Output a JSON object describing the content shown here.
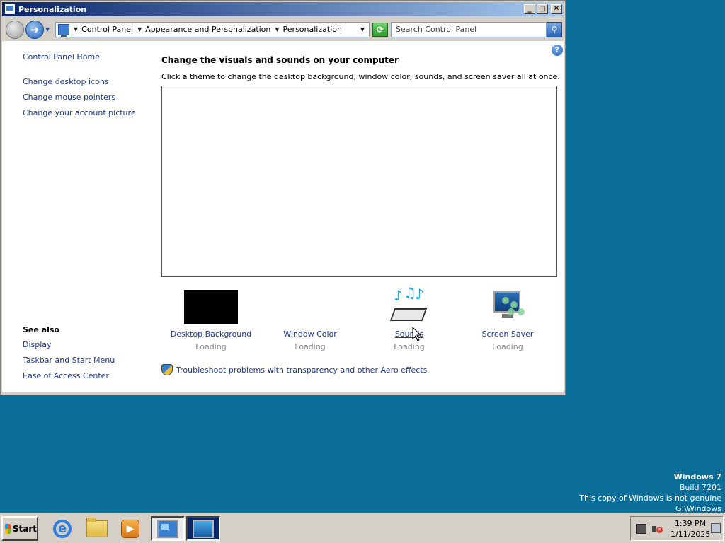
{
  "window": {
    "title": "Personalization",
    "controls": {
      "minimize": "_",
      "maximize": "□",
      "close": "✕"
    }
  },
  "addressbar": {
    "breadcrumbs": [
      "Control Panel",
      "Appearance and Personalization",
      "Personalization"
    ],
    "search_placeholder": "Search Control Panel"
  },
  "sidebar": {
    "home": "Control Panel Home",
    "links": [
      "Change desktop icons",
      "Change mouse pointers",
      "Change your account picture"
    ],
    "see_also_title": "See also",
    "see_also": [
      "Display",
      "Taskbar and Start Menu",
      "Ease of Access Center"
    ]
  },
  "main": {
    "heading": "Change the visuals and sounds on your computer",
    "subheading": "Click a theme to change the desktop background, window color, sounds, and screen saver all at once.",
    "options": [
      {
        "label": "Desktop Background",
        "status": "Loading"
      },
      {
        "label": "Window Color",
        "status": "Loading"
      },
      {
        "label": "Sounds",
        "status": "Loading"
      },
      {
        "label": "Screen Saver",
        "status": "Loading"
      }
    ],
    "troubleshoot": "Troubleshoot problems with transparency and other Aero effects"
  },
  "watermark": {
    "title": "Windows 7",
    "build": "Build 7201",
    "genuine": "This copy of Windows is not genuine",
    "path": "G:\\Windows"
  },
  "taskbar": {
    "start_label": "Start",
    "clock_time": "1:39 PM",
    "clock_date": "1/11/2025"
  }
}
